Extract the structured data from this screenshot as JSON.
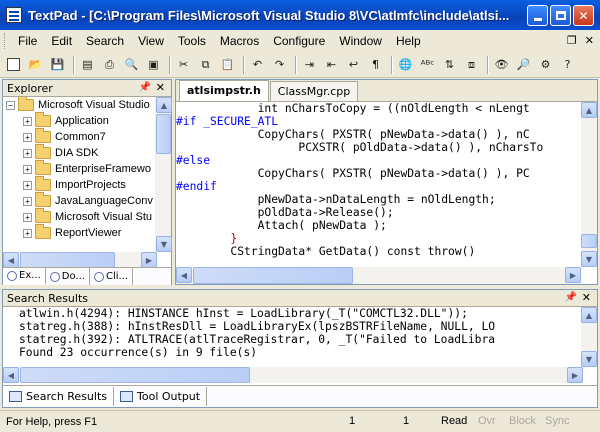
{
  "window": {
    "title": "TextPad - [C:\\Program Files\\Microsoft Visual Studio 8\\VC\\atlmfc\\include\\atlsi..."
  },
  "menu": {
    "items": [
      "File",
      "Edit",
      "Search",
      "View",
      "Tools",
      "Macros",
      "Configure",
      "Window",
      "Help"
    ]
  },
  "explorer": {
    "title": "Explorer",
    "tree": [
      "Microsoft Visual Studio",
      "Application",
      "Common7",
      "DIA SDK",
      "EnterpriseFramewo",
      "ImportProjects",
      "JavaLanguageConv",
      "Microsoft Visual Stu",
      "ReportViewer"
    ],
    "tabs": [
      "Ex...",
      "Do...",
      "Cli..."
    ]
  },
  "editor": {
    "tabs": [
      "atlsimpstr.h",
      "ClassMgr.cpp"
    ],
    "active_tab": "atlsimpstr.h",
    "code_lines": [
      "            int nCharsToCopy = ((nOldLength < nLengt",
      "#if _SECURE_ATL",
      "            CopyChars( PXSTR( pNewData->data() ), nC",
      "                  PCXSTR( pOldData->data() ), nCharsTo",
      "#else",
      "            CopyChars( PXSTR( pNewData->data() ), PC",
      "#endif",
      "            pNewData->nDataLength = nOldLength;",
      "            pOldData->Release();",
      "            Attach( pNewData );",
      "        }",
      "        CStringData* GetData() const throw()"
    ]
  },
  "search_results": {
    "title": "Search Results",
    "lines": [
      "atlwin.h(4294): HINSTANCE hInst = LoadLibrary(_T(\"COMCTL32.DLL\"));",
      "statreg.h(388): hInstResDll = LoadLibraryEx(lpszBSTRFileName, NULL, LO",
      "statreg.h(392): ATLTRACE(atlTraceRegistrar, 0, _T(\"Failed to LoadLibra",
      "Found 23 occurrence(s) in 9 file(s)"
    ],
    "tabs": [
      "Search Results",
      "Tool Output"
    ]
  },
  "status": {
    "message": "For Help, press F1",
    "line": "1",
    "col": "1",
    "read": "Read",
    "ovr": "Ovr",
    "block": "Block",
    "sync": "Sync"
  }
}
